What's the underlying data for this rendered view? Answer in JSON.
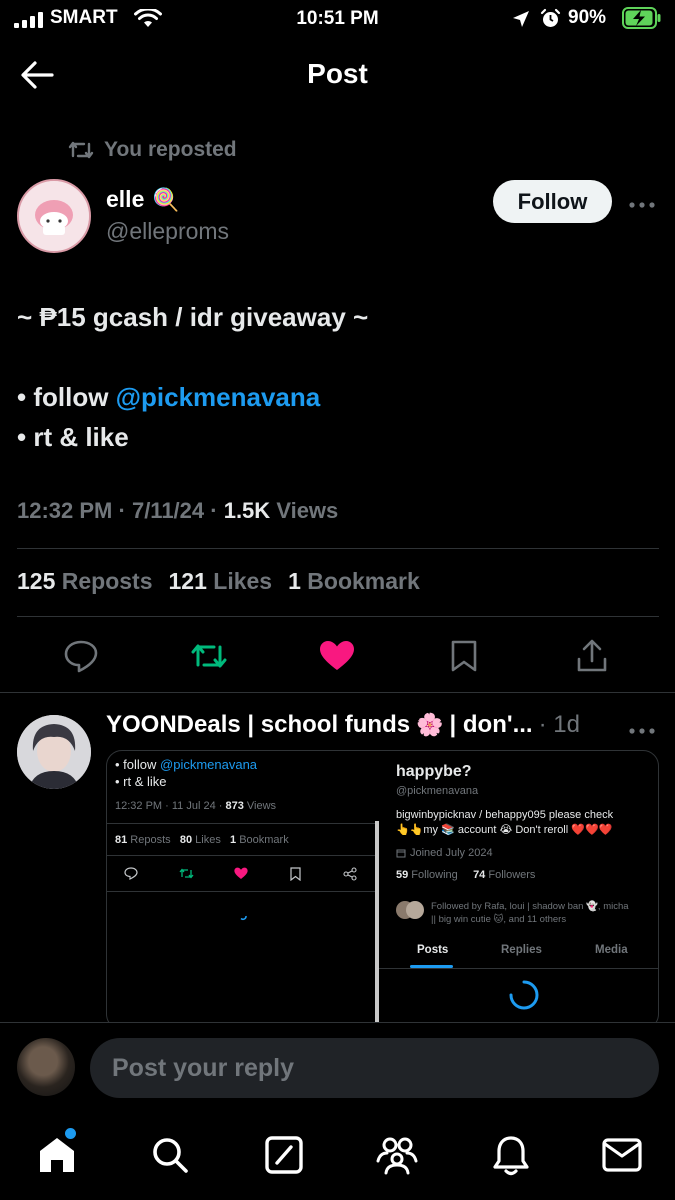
{
  "status_bar": {
    "carrier": "SMART",
    "time": "10:51 PM",
    "battery": "90%"
  },
  "header": {
    "title": "Post"
  },
  "tweet": {
    "reposted_label": "You reposted",
    "author_name": "elle",
    "author_emoji": "🍭",
    "handle": "@elleproms",
    "follow_label": "Follow",
    "line1": "~ ₱15 gcash / idr giveaway ~",
    "line2_prefix": "• follow ",
    "line2_mention": "@pickmenavana",
    "line3": "• rt & like",
    "time": "12:32 PM",
    "date": "7/11/24",
    "views_count": "1.5K",
    "views_label": "Views",
    "reposts_count": "125",
    "reposts_label": "Reposts",
    "likes_count": "121",
    "likes_label": "Likes",
    "bookmarks_count": "1",
    "bookmarks_label": "Bookmark"
  },
  "reply": {
    "name": "YOONDeals | school funds",
    "name_emoji": "🌸",
    "name_suffix": "| don'...",
    "time": "· 1d",
    "embed": {
      "left": {
        "line1_prefix": "• follow ",
        "line1_mention": "@pickmenavana",
        "line2": "• rt & like",
        "meta_time": "12:32 PM · 11 Jul 24 · ",
        "meta_views": "873",
        "meta_views_label": " Views",
        "reposts_count": "81",
        "reposts_label": " Reposts",
        "likes_count": "80",
        "likes_label": " Likes",
        "bookmarks_count": "1",
        "bookmarks_label": " Bookmark"
      },
      "right": {
        "name": "happybe?",
        "handle": "@pickmenavana",
        "bio_line1": "bigwinbypicknav / behappy095   please check",
        "bio_line2": "👆👆my 📚 account 😭 Don't reroll ❤️❤️❤️",
        "joined": "Joined July 2024",
        "following_count": "59",
        "following_label": " Following",
        "followers_count": "74",
        "followers_label": " Followers",
        "followed_by_line1": "Followed by Rafa, loui | shadow ban 👻, micha",
        "followed_by_line2": "|| big win cutie 🐱, and 11 others",
        "tabs": [
          "Posts",
          "Replies",
          "Media"
        ]
      }
    }
  },
  "composer": {
    "placeholder": "Post your reply"
  },
  "colors": {
    "accent": "#1d9bf0",
    "like": "#f91880",
    "repost": "#00ba7c",
    "muted": "#71767b"
  }
}
